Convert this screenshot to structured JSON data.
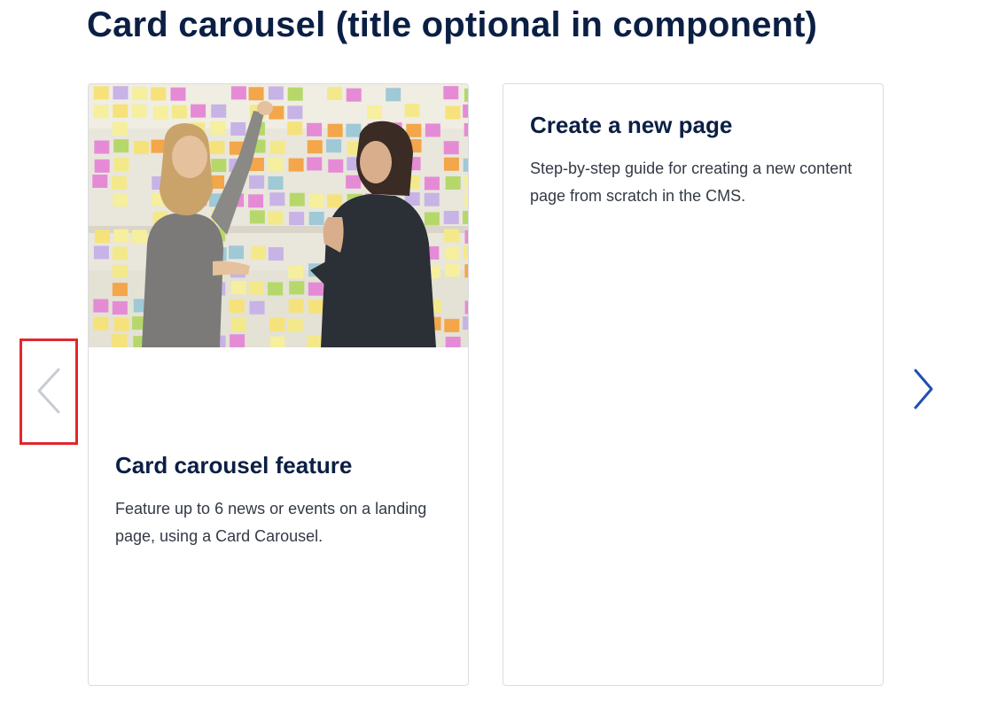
{
  "page": {
    "title": "Card carousel (title optional in component)"
  },
  "carousel": {
    "cards": [
      {
        "title": "Card carousel feature",
        "description": "Feature up to 6 news or events on a landing page, using a Card Carousel.",
        "has_image": true
      },
      {
        "title": "Create a new page",
        "description": "Step-by-step guide for creating a new content page from scratch in the CMS."
      }
    ],
    "prev": {
      "icon": "chevron-left-icon",
      "state": "disabled",
      "highlighted": true
    },
    "next": {
      "icon": "chevron-right-icon",
      "state": "enabled"
    }
  },
  "colors": {
    "title": "#0b1f44",
    "body_text": "#333a45",
    "card_border": "#d9dce1",
    "next_arrow": "#1f4fb4",
    "prev_arrow_disabled": "#c8ccd2",
    "highlight_box": "#e0282c"
  }
}
